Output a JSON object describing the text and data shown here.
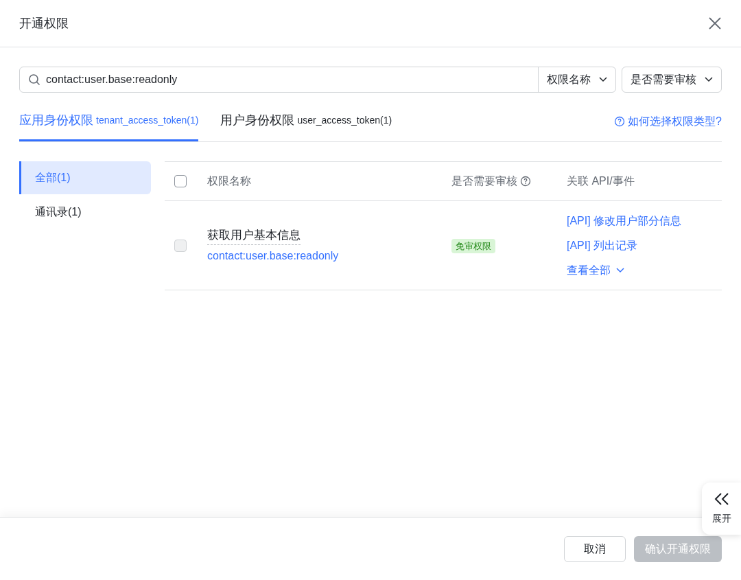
{
  "dialog": {
    "title": "开通权限"
  },
  "search": {
    "value": "contact:user.base:readonly"
  },
  "filters": [
    {
      "label": "权限名称"
    },
    {
      "label": "是否需要审核"
    }
  ],
  "tabs": [
    {
      "label": "应用身份权限",
      "token": "tenant_access_token(1)",
      "selected": true
    },
    {
      "label": "用户身份权限",
      "token": "user_access_token(1)",
      "selected": false
    }
  ],
  "help_link": "如何选择权限类型?",
  "categories": [
    {
      "label": "全部(1)",
      "selected": true
    },
    {
      "label": "通讯录(1)",
      "selected": false
    }
  ],
  "table": {
    "columns": [
      "权限名称",
      "是否需要审核",
      "关联 API/事件"
    ],
    "header_checked": false,
    "rows": [
      {
        "checked": false,
        "disabled": true,
        "name": "获取用户基本信息",
        "scope": "contact:user.base:readonly",
        "review": "免审权限",
        "apis": [
          "[API] 修改用户部分信息",
          "[API] 列出记录"
        ],
        "more": "查看全部"
      }
    ]
  },
  "side_tab": {
    "label": "展开"
  },
  "buttons": {
    "cancel": "取消",
    "confirm": {
      "label": "确认开通权限",
      "disabled": true
    }
  }
}
